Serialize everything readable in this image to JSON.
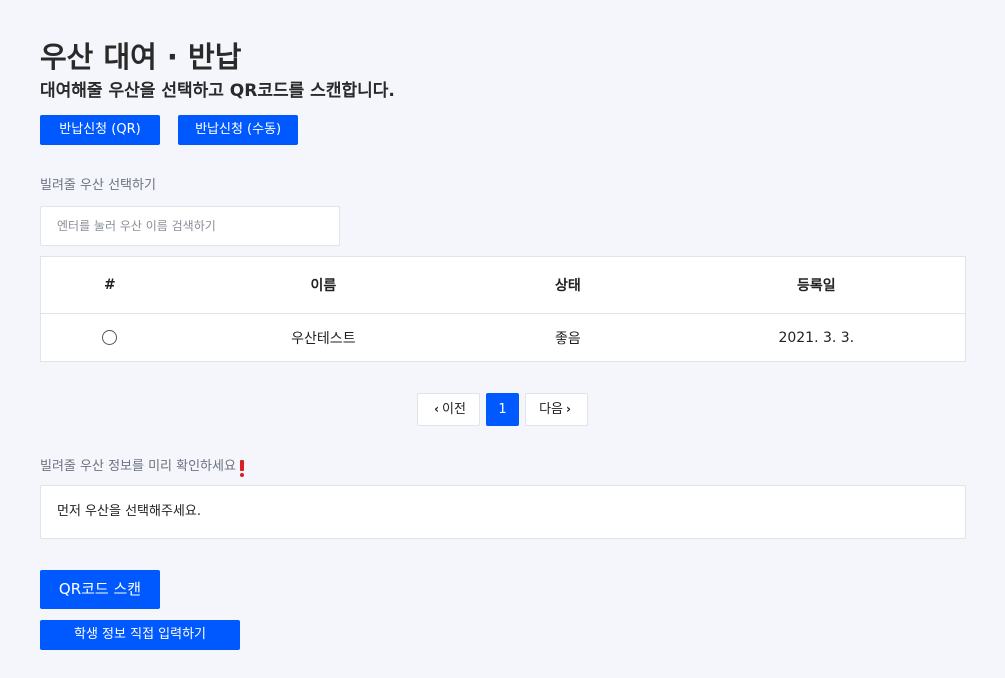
{
  "header": {
    "title": "우산 대여 · 반납",
    "subtitle": "대여해줄 우산을 선택하고 QR코드를 스캔합니다."
  },
  "actions": {
    "return_qr_label": "반납신청 (QR)",
    "return_manual_label": "반납신청 (수동)"
  },
  "select_section": {
    "label": "빌려줄 우산 선택하기",
    "search_placeholder": "엔터를 눌러 우산 이름 검색하기",
    "search_value": ""
  },
  "table": {
    "columns": [
      "#",
      "이름",
      "상태",
      "등록일"
    ],
    "rows": [
      {
        "selected": false,
        "name": "우산테스트",
        "status": "좋음",
        "registered": "2021. 3. 3."
      }
    ]
  },
  "pagination": {
    "prev_label": "이전",
    "next_label": "다음",
    "current_page": "1"
  },
  "info_section": {
    "label": "빌려줄 우산 정보를 미리 확인하세요",
    "message": "먼저 우산을 선택해주세요."
  },
  "footer_actions": {
    "scan_label": "QR코드 스캔",
    "manual_input_label": "학생 정보 직접 입력하기"
  },
  "colors": {
    "accent": "#0058ff",
    "background": "#f4f6fb",
    "warning": "#d92020"
  },
  "icons": {
    "prev": "chevron-left-icon",
    "next": "chevron-right-icon",
    "warning": "exclamation-icon",
    "row_select": "radio-icon"
  }
}
